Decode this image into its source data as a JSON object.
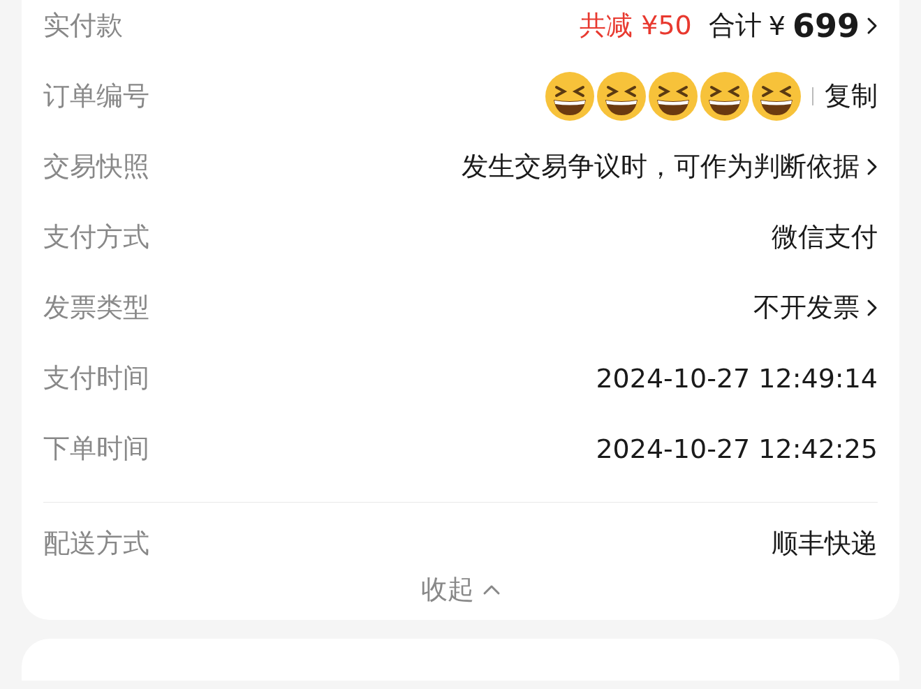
{
  "order_details": [
    {
      "kind": "amount",
      "label": "实付款",
      "discount": "共减 ¥50",
      "total_label": "合计",
      "currency": "¥",
      "total": "699",
      "has_arrow": true
    },
    {
      "kind": "order_number",
      "label": "订单编号",
      "action": "复制"
    },
    {
      "kind": "text",
      "label": "交易快照",
      "value": "发生交易争议时，可作为判断依据",
      "has_arrow": true
    },
    {
      "kind": "text",
      "label": "支付方式",
      "value": "微信支付",
      "has_arrow": false
    },
    {
      "kind": "text",
      "label": "发票类型",
      "value": "不开发票",
      "has_arrow": true
    },
    {
      "kind": "text",
      "label": "支付时间",
      "value": "2024-10-27 12:49:14",
      "has_arrow": false
    },
    {
      "kind": "text",
      "label": "下单时间",
      "value": "2024-10-27 12:42:25",
      "has_arrow": false
    }
  ],
  "delivery": [
    {
      "kind": "text",
      "label": "配送方式",
      "value": "顺丰快递",
      "has_arrow": false
    }
  ],
  "collapse_button": {
    "label": "收起",
    "expanded": true
  }
}
